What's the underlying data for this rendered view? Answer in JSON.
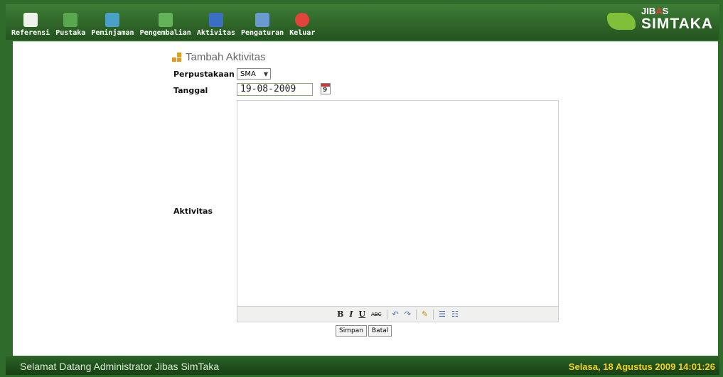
{
  "nav": {
    "items": [
      {
        "label": "Referensi",
        "color": "#eef3ea"
      },
      {
        "label": "Pustaka",
        "color": "#5aa84d"
      },
      {
        "label": "Peminjaman",
        "color": "#4aa0c7"
      },
      {
        "label": "Pengembalian",
        "color": "#63b35a"
      },
      {
        "label": "Aktivitas",
        "color": "#3b6fc4"
      },
      {
        "label": "Pengaturan",
        "color": "#6b9ad1"
      },
      {
        "label": "Keluar",
        "color": "#e0443a"
      }
    ]
  },
  "logo": {
    "line1_a": "JIB",
    "line1_b": "A",
    "line1_c": "S",
    "line2": "SIMTAKA"
  },
  "form": {
    "title": "Tambah Aktivitas",
    "perpustakaan_label": "Perpustakaan",
    "perpustakaan_value": "SMA",
    "tanggal_label": "Tanggal",
    "tanggal_value": "19-08-2009",
    "calendar_day": "9",
    "aktivitas_label": "Aktivitas",
    "simpan": "Simpan",
    "batal": "Batal"
  },
  "toolbar": {
    "bold": "B",
    "italic": "I",
    "underline": "U",
    "strike": "ABC",
    "undo": "↶",
    "redo": "↷",
    "cleanup": "✎",
    "bullist": "☰",
    "numlist": "☷"
  },
  "footer": {
    "welcome": "Selamat Datang Administrator Jibas SimTaka",
    "datetime": "Selasa, 18 Agustus 2009 14:01:26"
  }
}
